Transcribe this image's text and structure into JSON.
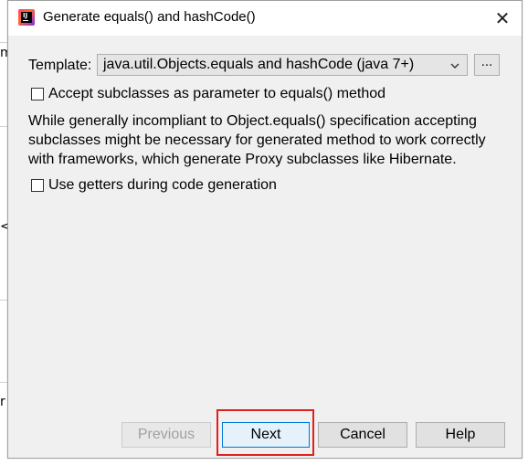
{
  "background": {
    "fragments": [
      "m",
      "<)",
      "r"
    ]
  },
  "dialog": {
    "title": "Generate equals() and hashCode()",
    "app_icon_text": "IJ",
    "close_glyph": "✕"
  },
  "template": {
    "label": "Template:",
    "selected_value": "java.util.Objects.equals and hashCode (java 7+)",
    "ellipsis_label": "..."
  },
  "options": {
    "accept_subclasses_label": "Accept subclasses as parameter to equals() method",
    "accept_subclasses_checked": false,
    "description_lines": [
      "While generally incompliant to Object.equals() specification accepting",
      "subclasses might be necessary for generated method to work correctly",
      "with frameworks, which generate Proxy subclasses like Hibernate."
    ],
    "use_getters_label": "Use getters during code generation",
    "use_getters_checked": false
  },
  "buttons": {
    "previous": "Previous",
    "next": "Next",
    "cancel": "Cancel",
    "help": "Help"
  },
  "colors": {
    "highlight": "#e0201c",
    "default_button_border": "#0078d7"
  }
}
